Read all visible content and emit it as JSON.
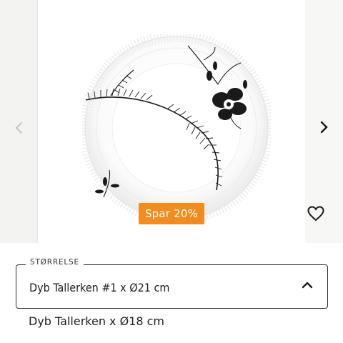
{
  "gallery": {
    "prev_icon": "chevron-left-icon",
    "next_icon": "chevron-right-icon",
    "badge": "Spar 20%",
    "favorite_icon": "heart-icon"
  },
  "size_selector": {
    "legend": "STØRRELSE",
    "selected": "Dyb Tallerken #1 x Ø21 cm",
    "toggle_icon": "chevron-up-icon",
    "options": [
      "Dyb Tallerken x Ø18 cm"
    ]
  },
  "colors": {
    "badge_bg": "#f28c1e",
    "text": "#1e1e1e",
    "gallery_bg": "#f4f4f2"
  }
}
